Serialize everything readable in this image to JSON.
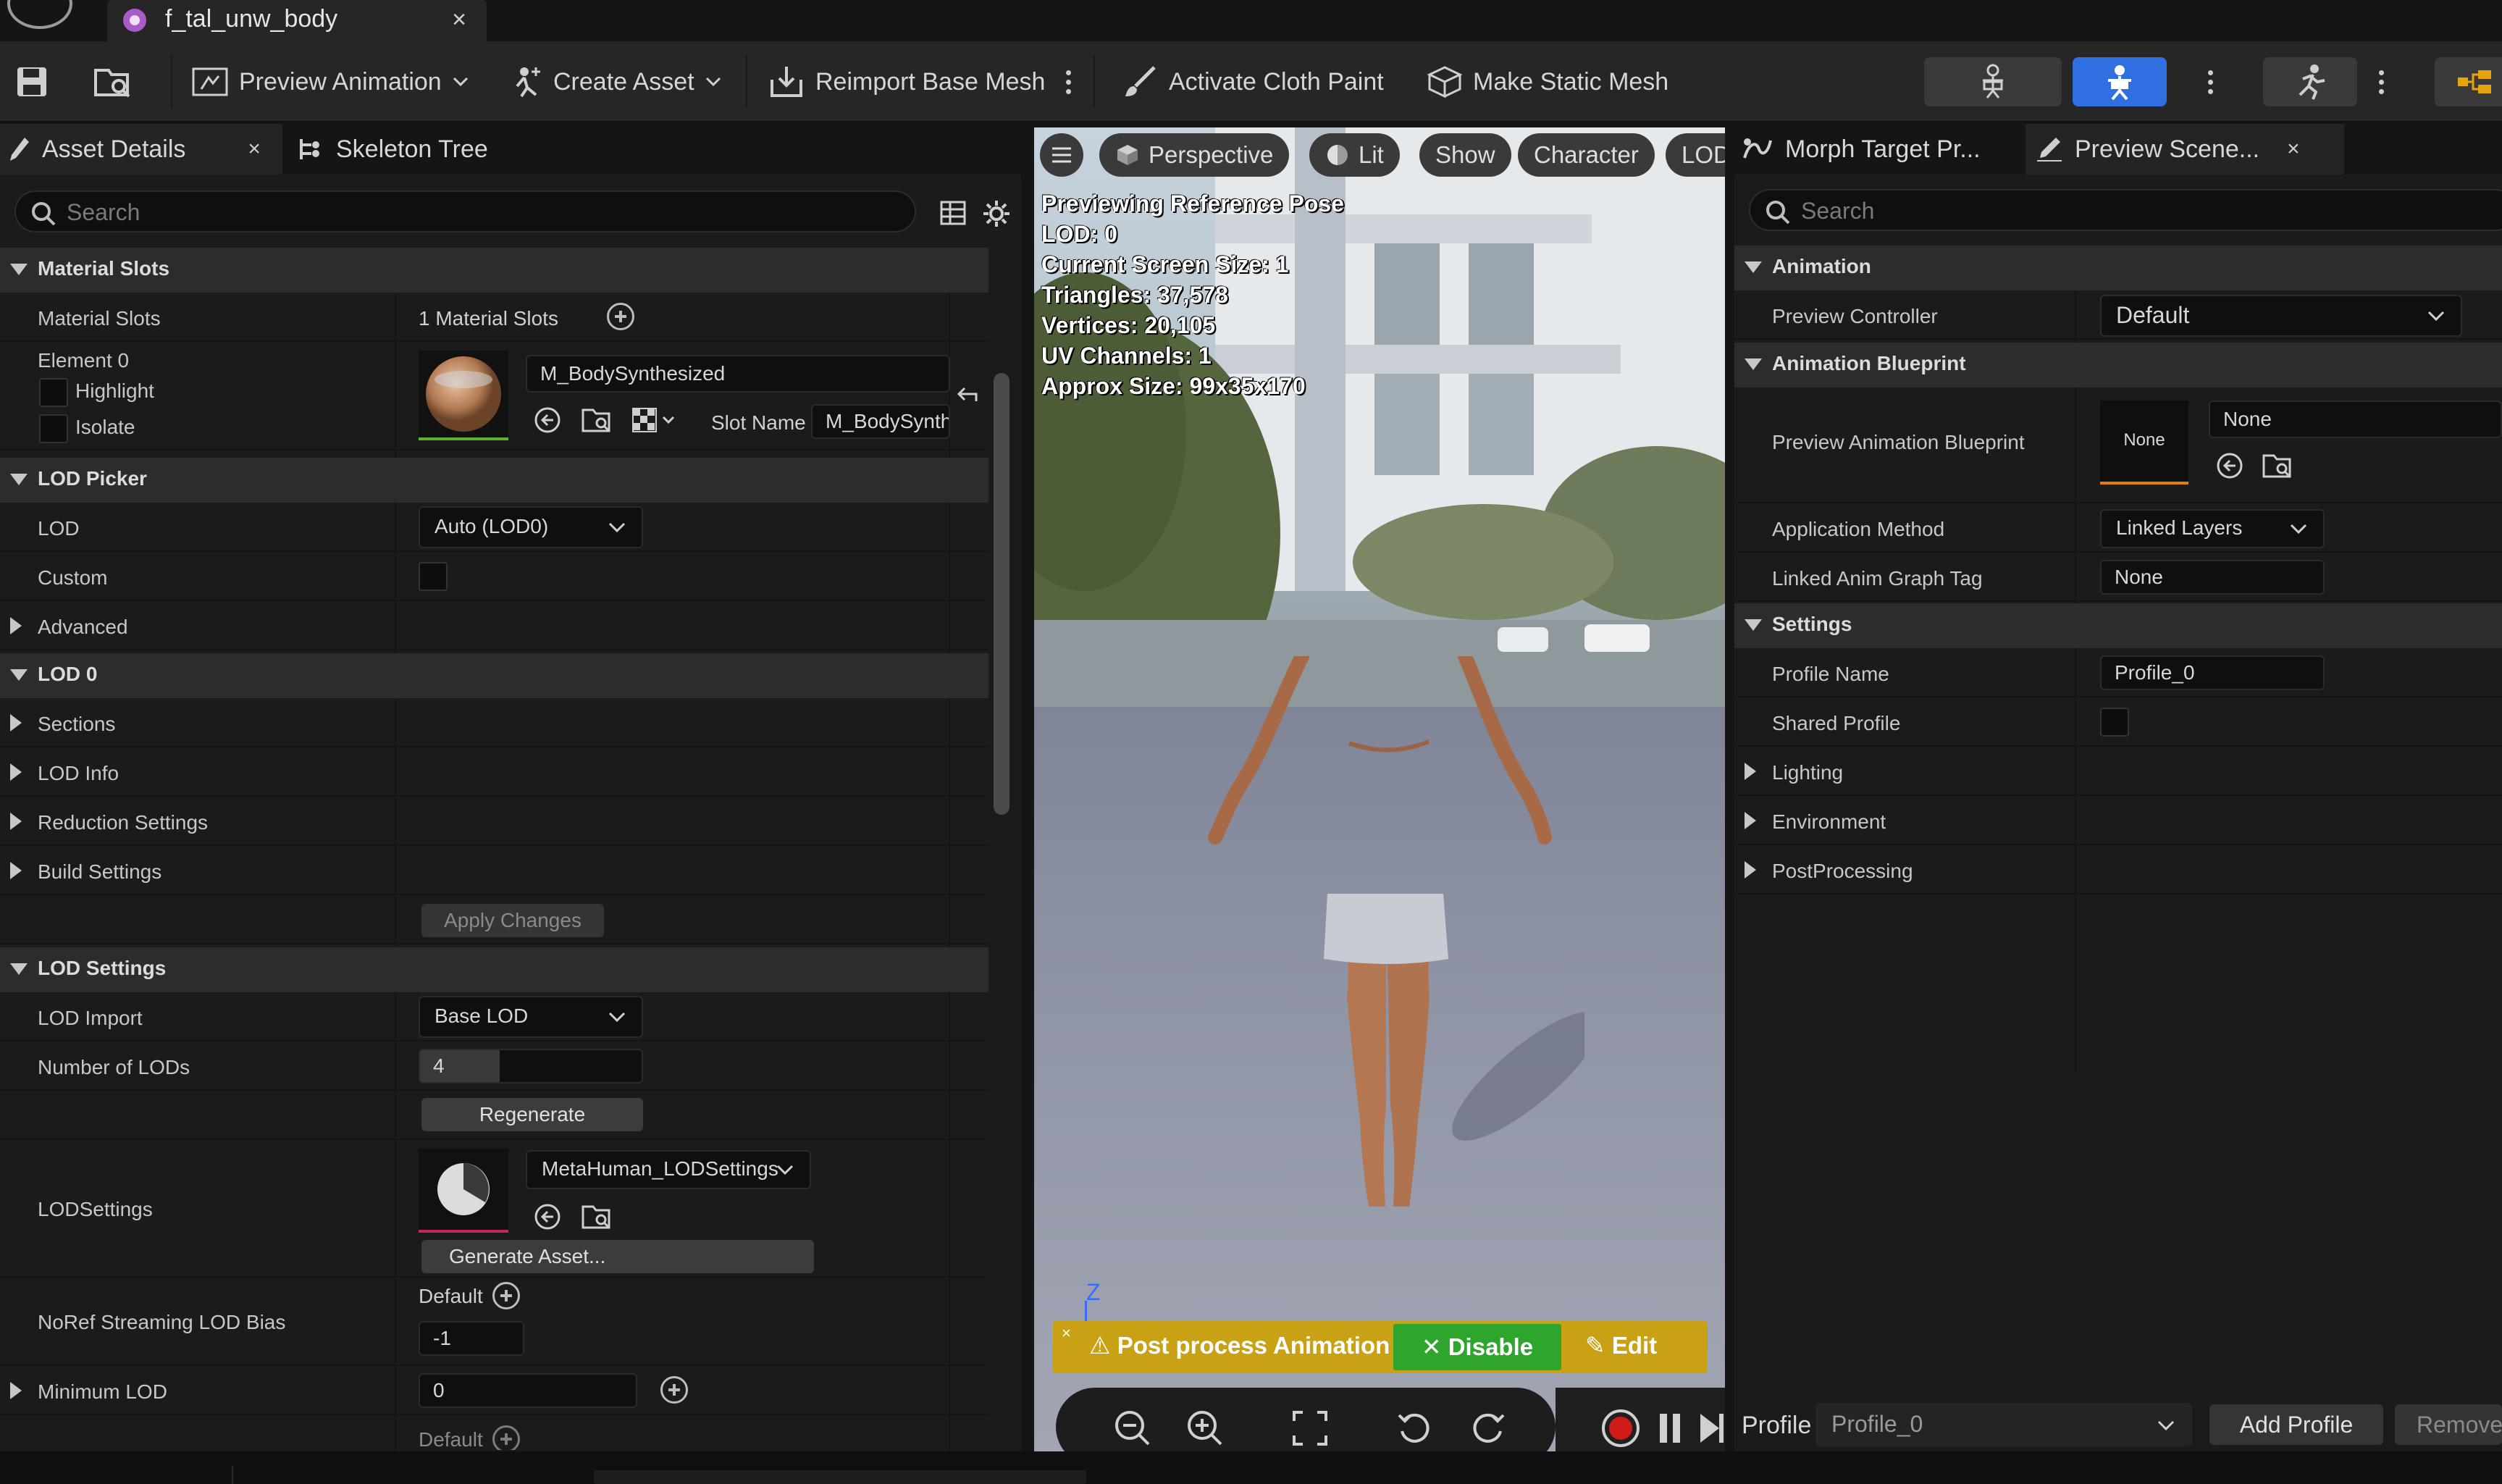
{
  "window": {
    "tab_title": "f_tal_unw_body",
    "close": "×"
  },
  "toolbar": {
    "preview_animation": "Preview Animation",
    "create_asset": "Create Asset",
    "reimport_base_mesh": "Reimport Base Mesh",
    "activate_cloth_paint": "Activate Cloth Paint",
    "make_static_mesh": "Make Static Mesh"
  },
  "left_panel": {
    "tabs": [
      {
        "label": "Asset Details",
        "close": "×"
      },
      {
        "label": "Skeleton Tree"
      }
    ],
    "search_placeholder": "Search",
    "material_slots": {
      "header": "Material Slots",
      "label": "Material Slots",
      "count": "1 Material Slots",
      "element": "Element 0",
      "highlight": "Highlight",
      "isolate": "Isolate",
      "material": "M_BodySynthesized",
      "slot_name_label": "Slot Name",
      "slot_name": "M_BodySynth"
    },
    "lod_picker": {
      "header": "LOD Picker",
      "lod_label": "LOD",
      "lod_value": "Auto (LOD0)",
      "custom_label": "Custom",
      "advanced": "Advanced"
    },
    "lod0": {
      "header": "LOD 0",
      "sections": "Sections",
      "lod_info": "LOD Info",
      "reduction": "Reduction Settings",
      "build": "Build Settings",
      "apply": "Apply Changes"
    },
    "lod_settings": {
      "header": "LOD Settings",
      "lod_import_label": "LOD Import",
      "lod_import_value": "Base LOD",
      "num_lods_label": "Number of LODs",
      "num_lods_value": "4",
      "regenerate": "Regenerate",
      "lodsettings_label": "LODSettings",
      "lodsettings_value": "MetaHuman_LODSettings",
      "generate_asset": "Generate Asset...",
      "noref_label": "NoRef Streaming LOD Bias",
      "noref_default": "Default",
      "noref_value": "-1",
      "min_lod_label": "Minimum LOD",
      "min_lod_value": "0",
      "bottom_default": "Default"
    }
  },
  "viewport": {
    "perspective": "Perspective",
    "lit": "Lit",
    "show": "Show",
    "character": "Character",
    "lod": "LOD",
    "stats": [
      "Previewing Reference Pose",
      "LOD: 0",
      "Current Screen Size: 1",
      "Triangles: 37,578",
      "Vertices: 20,105",
      "UV Channels: 1",
      "Approx Size: 99x35x170"
    ],
    "axis": "Z",
    "post_process": "Post process Animation",
    "disable": "Disable",
    "edit": "Edit"
  },
  "right_panel": {
    "tabs": [
      {
        "label": "Morph Target Pr..."
      },
      {
        "label": "Preview Scene...",
        "close": "×"
      }
    ],
    "search_placeholder": "Search",
    "animation": {
      "header": "Animation",
      "preview_controller_label": "Preview Controller",
      "preview_controller_value": "Default"
    },
    "animation_blueprint": {
      "header": "Animation Blueprint",
      "preview_bp_label": "Preview Animation Blueprint",
      "thumb_text": "None",
      "bp_value": "None",
      "app_method_label": "Application Method",
      "app_method_value": "Linked Layers",
      "linked_tag_label": "Linked Anim Graph Tag",
      "linked_tag_value": "None"
    },
    "settings": {
      "header": "Settings",
      "profile_name_label": "Profile Name",
      "profile_name_value": "Profile_0",
      "shared_profile_label": "Shared Profile",
      "lighting": "Lighting",
      "environment": "Environment",
      "postprocessing": "PostProcessing"
    },
    "footer": {
      "profile_label": "Profile",
      "profile_value": "Profile_0",
      "add_profile": "Add Profile",
      "remove": "Remove"
    }
  },
  "colors": {
    "accent_blue": "#2f6fe0",
    "warning_yellow": "#c8a214",
    "disable_green": "#2ea52c",
    "record_red": "#d11a1a"
  }
}
